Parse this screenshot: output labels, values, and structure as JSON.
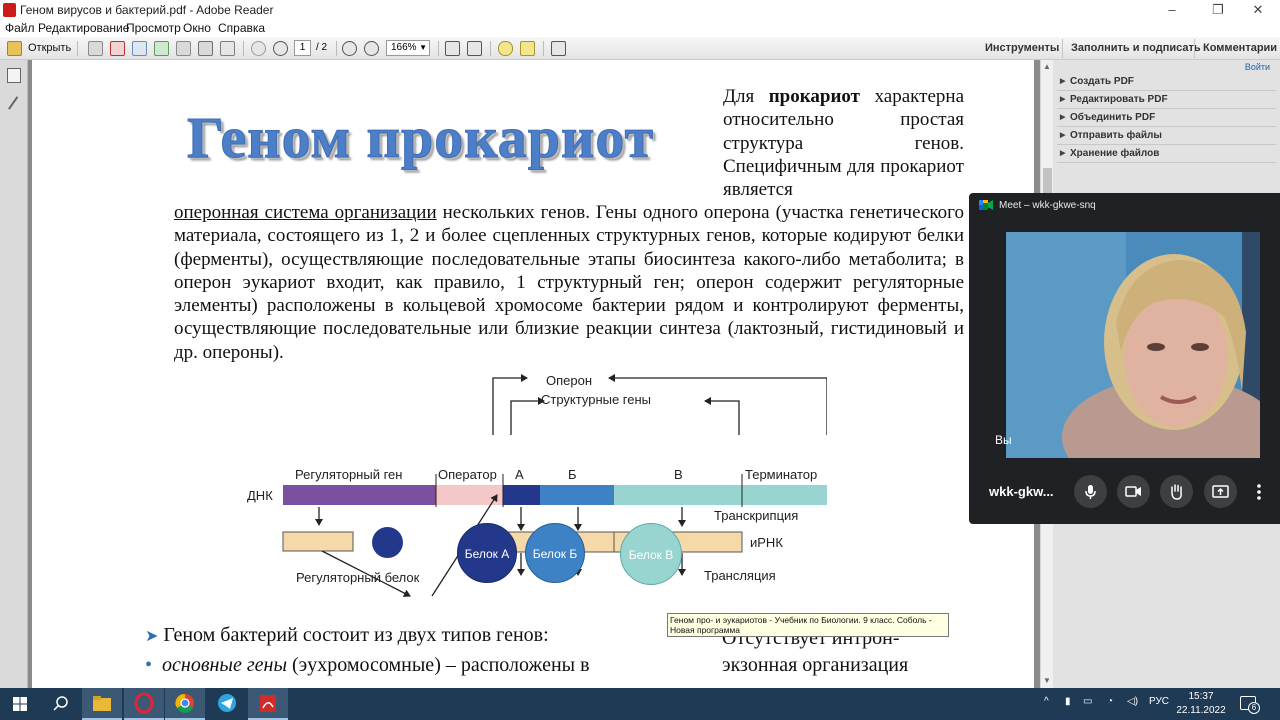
{
  "window": {
    "title": "Геном вирусов и бактерий.pdf - Adobe Reader",
    "minimize": "–",
    "restore": "❐",
    "close": "✕"
  },
  "menu": [
    "Файл",
    "Редактирование",
    "Просмотр",
    "Окно",
    "Справка"
  ],
  "toolbar": {
    "open_label": "Открыть",
    "page_current": "1",
    "page_total": "/ 2",
    "zoom": "166%",
    "tools": "Инструменты",
    "fill_sign": "Заполнить и подписать",
    "comments": "Комментарии"
  },
  "right_panel": {
    "signin": "Войти",
    "items": [
      "Создать PDF",
      "Редактировать PDF",
      "Объединить PDF",
      "Отправить файлы",
      "Хранение файлов"
    ]
  },
  "document": {
    "heading": "Геном прокариот",
    "para1_a": "Для ",
    "para1_bold": "прокариот",
    "para1_b": " характерна относительно простая структура генов. Специфичным для прокариот является",
    "para2_underline": "оперонная система организации",
    "para2_rest": " нескольких генов. Гены одного оперона (участка генетического материала, состоящего из 1, 2 и более сцепленных структурных генов, которые кодируют белки (ферменты), осуществляющие последовательные этапы биосинтеза какого-либо метаболита; в оперон эукариот входит, как правило, 1 структурный ген; оперон содержит регуляторные элементы) расположены в кольцевой хромосоме бактерии рядом и контролируют ферменты, осуществляющие последовательные или близкие реакции синтеза (лактозный, гистидиновый и др. опероны).",
    "diagram": {
      "operon": "Оперон",
      "structural_genes": "Структурные гены",
      "regulatory_gene": "Регуляторный ген",
      "operator": "Оператор",
      "gene_a": "А",
      "gene_b": "Б",
      "gene_v": "В",
      "terminator": "Терминатор",
      "dna": "ДНК",
      "transcription": "Транскрипция",
      "mrna": "иРНК",
      "translation": "Трансляция",
      "protein_a": "Белок А",
      "protein_b": "Белок Б",
      "protein_v": "Белок В",
      "regulatory_protein": "Регуляторный белок",
      "colors": {
        "regulatory": "#7c4f9f",
        "operator": "#f5c7c9",
        "gene_a": "#23388a",
        "gene_b": "#3d82c4",
        "gene_v": "#98d4d0",
        "mrna": "#f6d9a8"
      }
    },
    "bullet1": "Геном бактерий состоит из двух типов генов:",
    "bullet2_italic": "основные гены",
    "bullet2_rest": " (эухромосомные) – расположены в",
    "right_col_line1": "Отсутствует  интрон-",
    "right_col_line2": "экзонная организация"
  },
  "tooltip": "Геном про- и эукариотов - Учебник по Биологии. 9 класс. Соболь - Новая программа",
  "meet": {
    "title": "Meet – wkk-gkwe-snq",
    "you_label": "Вы",
    "meeting_short": "wkk-gkw..."
  },
  "taskbar": {
    "lang": "РУС",
    "time": "15:37",
    "date": "22.11.2022",
    "notifications": "6"
  }
}
